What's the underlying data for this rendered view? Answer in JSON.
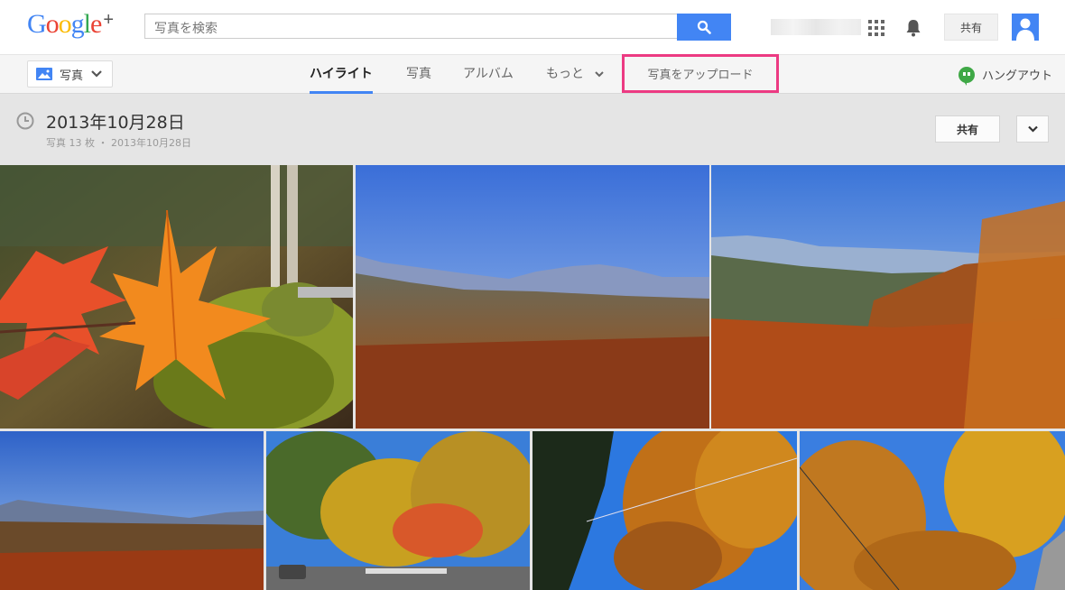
{
  "header": {
    "logo_text": "Google",
    "logo_plus": "+",
    "search_placeholder": "写真を検索",
    "share_label": "共有",
    "logo_colors": [
      "#4285f4",
      "#ea4335",
      "#fbbc05",
      "#4285f4",
      "#34a853",
      "#ea4335"
    ]
  },
  "nav": {
    "photos_dropdown_label": "写真",
    "tabs": [
      {
        "label": "ハイライト",
        "active": true
      },
      {
        "label": "写真",
        "active": false
      },
      {
        "label": "アルバム",
        "active": false
      },
      {
        "label": "もっと",
        "active": false
      }
    ],
    "upload_label": "写真をアップロード",
    "hangouts_label": "ハングアウト"
  },
  "album": {
    "title": "2013年10月28日",
    "subtitle": "写真 13 枚 ・ 2013年10月28日",
    "share_label": "共有"
  },
  "photos": [
    {
      "name": "photo-maple-leaves"
    },
    {
      "name": "photo-valley-mountains"
    },
    {
      "name": "photo-autumn-valley-right"
    },
    {
      "name": "photo-distant-mountains"
    },
    {
      "name": "photo-roadside-autumn-trees"
    },
    {
      "name": "photo-trees-blue-sky"
    },
    {
      "name": "photo-autumn-canopy"
    }
  ],
  "colors": {
    "accent_blue": "#4285f4",
    "upload_highlight": "#ec3a82",
    "hangouts_green": "#3fa846"
  }
}
